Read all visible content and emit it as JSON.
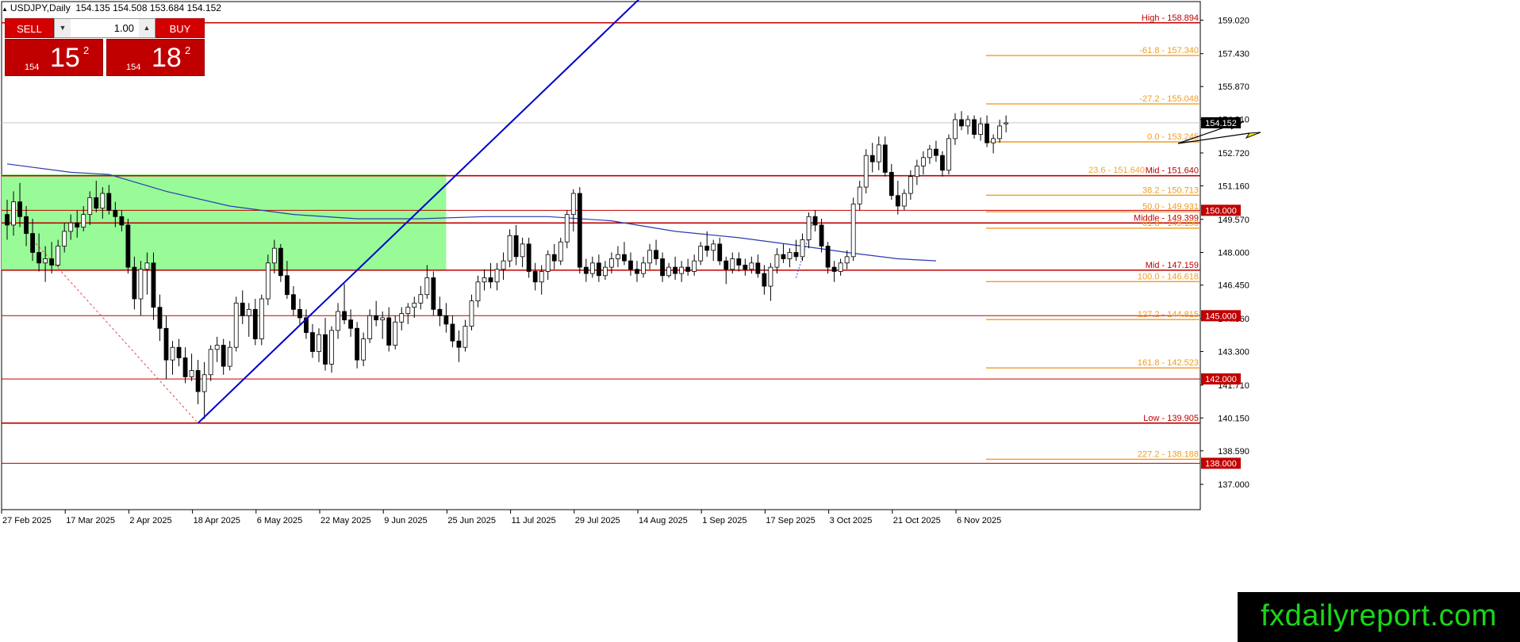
{
  "header": {
    "symbol": "USDJPY,Daily",
    "ohlc": "154.135 154.508 153.684 154.152"
  },
  "trade_panel": {
    "sell_label": "SELL",
    "buy_label": "BUY",
    "lot_value": "1.00",
    "sell_price": {
      "big": "154",
      "main": "15",
      "sup": "2"
    },
    "buy_price": {
      "big": "154",
      "main": "18",
      "sup": "2"
    }
  },
  "brand": "fxdailyreport.com",
  "colors": {
    "bull": "#ffffff",
    "bear": "#000000",
    "red_line": "#c00000",
    "fib": "#f39c1f",
    "trendline": "#0000cc",
    "ma": "#2b3bb0",
    "zone": "#98fb98"
  },
  "chart_data": {
    "type": "candlestick",
    "symbol": "USDJPY",
    "timeframe": "Daily",
    "ylim": [
      135.8,
      159.9
    ],
    "y_ticks": [
      "159.020",
      "157.430",
      "155.870",
      "154.310",
      "152.720",
      "151.160",
      "149.570",
      "148.000",
      "146.450",
      "144.860",
      "143.300",
      "141.710",
      "140.150",
      "138.590",
      "137.000"
    ],
    "x_ticks": [
      "27 Feb 2025",
      "17 Mar 2025",
      "2 Apr 2025",
      "18 Apr 2025",
      "6 May 2025",
      "22 May 2025",
      "9 Jun 2025",
      "25 Jun 2025",
      "11 Jul 2025",
      "29 Jul 2025",
      "14 Aug 2025",
      "1 Sep 2025",
      "17 Sep 2025",
      "3 Oct 2025",
      "21 Oct 2025",
      "6 Nov 2025"
    ],
    "current_price": "154.152",
    "candles": [
      [
        149.8,
        150.5,
        148.6,
        149.3
      ],
      [
        149.3,
        150.9,
        148.8,
        150.4
      ],
      [
        150.4,
        151.3,
        149.2,
        149.7
      ],
      [
        149.7,
        150.2,
        148.3,
        148.9
      ],
      [
        148.9,
        149.6,
        147.6,
        148.0
      ],
      [
        148.0,
        148.9,
        147.1,
        147.5
      ],
      [
        147.5,
        148.3,
        146.6,
        147.7
      ],
      [
        147.7,
        148.5,
        147.0,
        147.4
      ],
      [
        147.4,
        148.6,
        147.3,
        148.3
      ],
      [
        148.3,
        149.4,
        148.0,
        149.0
      ],
      [
        149.0,
        149.8,
        148.6,
        149.4
      ],
      [
        149.4,
        150.0,
        148.7,
        149.2
      ],
      [
        149.2,
        150.2,
        149.0,
        149.8
      ],
      [
        149.8,
        150.9,
        149.3,
        150.6
      ],
      [
        150.6,
        151.4,
        149.9,
        150.1
      ],
      [
        150.1,
        151.1,
        149.6,
        150.8
      ],
      [
        150.8,
        151.2,
        149.8,
        150.0
      ],
      [
        150.0,
        150.4,
        149.2,
        149.7
      ],
      [
        149.7,
        150.0,
        149.0,
        149.3
      ],
      [
        149.3,
        149.6,
        147.0,
        147.3
      ],
      [
        147.3,
        147.8,
        145.3,
        145.8
      ],
      [
        145.8,
        147.6,
        145.0,
        147.2
      ],
      [
        147.2,
        148.0,
        146.0,
        147.5
      ],
      [
        147.5,
        148.0,
        144.8,
        145.4
      ],
      [
        145.4,
        146.0,
        143.8,
        144.4
      ],
      [
        144.4,
        145.0,
        142.0,
        142.9
      ],
      [
        142.9,
        143.8,
        142.2,
        143.5
      ],
      [
        143.5,
        143.9,
        142.6,
        143.0
      ],
      [
        143.0,
        143.5,
        141.8,
        142.1
      ],
      [
        142.1,
        143.2,
        141.9,
        142.4
      ],
      [
        142.4,
        142.9,
        140.8,
        141.4
      ],
      [
        141.4,
        142.8,
        140.1,
        142.2
      ],
      [
        142.2,
        143.6,
        141.9,
        143.4
      ],
      [
        143.4,
        144.0,
        142.8,
        143.6
      ],
      [
        143.6,
        143.9,
        142.2,
        142.6
      ],
      [
        142.6,
        143.8,
        142.4,
        143.5
      ],
      [
        143.5,
        145.9,
        143.3,
        145.6
      ],
      [
        145.6,
        146.2,
        144.6,
        145.0
      ],
      [
        145.0,
        145.6,
        144.0,
        145.3
      ],
      [
        145.3,
        145.8,
        143.6,
        143.9
      ],
      [
        143.9,
        146.0,
        143.6,
        145.8
      ],
      [
        145.8,
        147.9,
        145.5,
        147.5
      ],
      [
        147.5,
        148.6,
        147.0,
        148.2
      ],
      [
        148.2,
        148.4,
        146.6,
        146.9
      ],
      [
        146.9,
        147.6,
        145.8,
        146.0
      ],
      [
        146.0,
        146.4,
        145.0,
        145.3
      ],
      [
        145.3,
        145.8,
        144.6,
        144.9
      ],
      [
        144.9,
        145.3,
        143.9,
        144.2
      ],
      [
        144.2,
        144.6,
        143.0,
        143.3
      ],
      [
        143.3,
        144.4,
        142.8,
        144.1
      ],
      [
        144.1,
        144.9,
        142.4,
        142.7
      ],
      [
        142.7,
        144.5,
        142.3,
        144.3
      ],
      [
        144.3,
        145.6,
        143.9,
        145.2
      ],
      [
        145.2,
        146.5,
        144.6,
        144.8
      ],
      [
        144.8,
        145.3,
        144.0,
        144.4
      ],
      [
        144.4,
        144.7,
        142.5,
        142.9
      ],
      [
        142.9,
        144.2,
        142.6,
        143.9
      ],
      [
        143.9,
        145.3,
        143.7,
        145.0
      ],
      [
        145.0,
        145.7,
        144.5,
        144.8
      ],
      [
        144.8,
        145.2,
        143.9,
        144.9
      ],
      [
        144.9,
        145.4,
        143.3,
        143.6
      ],
      [
        143.6,
        145.0,
        143.4,
        144.7
      ],
      [
        144.7,
        145.4,
        144.3,
        145.1
      ],
      [
        145.1,
        145.6,
        144.6,
        145.4
      ],
      [
        145.4,
        145.9,
        144.9,
        145.6
      ],
      [
        145.6,
        146.4,
        145.3,
        146.0
      ],
      [
        146.0,
        147.4,
        145.8,
        146.8
      ],
      [
        146.8,
        147.1,
        145.0,
        145.3
      ],
      [
        145.3,
        145.9,
        144.5,
        145.0
      ],
      [
        145.0,
        145.6,
        144.2,
        144.6
      ],
      [
        144.6,
        145.0,
        143.5,
        143.8
      ],
      [
        143.8,
        144.3,
        142.8,
        143.5
      ],
      [
        143.5,
        144.8,
        143.3,
        144.5
      ],
      [
        144.5,
        146.0,
        144.3,
        145.7
      ],
      [
        145.7,
        146.9,
        145.4,
        146.6
      ],
      [
        146.6,
        147.2,
        146.2,
        146.8
      ],
      [
        146.8,
        147.5,
        146.3,
        146.6
      ],
      [
        146.6,
        147.5,
        146.2,
        147.2
      ],
      [
        147.2,
        148.0,
        146.7,
        147.6
      ],
      [
        147.6,
        149.1,
        147.3,
        148.8
      ],
      [
        148.8,
        149.3,
        147.4,
        147.8
      ],
      [
        147.8,
        148.7,
        147.3,
        148.4
      ],
      [
        148.4,
        148.7,
        146.8,
        147.1
      ],
      [
        147.1,
        147.5,
        146.2,
        146.6
      ],
      [
        146.6,
        147.4,
        146.0,
        147.1
      ],
      [
        147.1,
        148.1,
        146.7,
        147.9
      ],
      [
        147.9,
        148.4,
        147.2,
        147.6
      ],
      [
        147.6,
        148.7,
        147.4,
        148.5
      ],
      [
        148.5,
        150.0,
        148.2,
        149.8
      ],
      [
        149.8,
        151.0,
        149.0,
        150.8
      ],
      [
        150.8,
        151.1,
        147.0,
        147.3
      ],
      [
        147.3,
        147.7,
        146.6,
        147.0
      ],
      [
        147.0,
        147.8,
        146.8,
        147.5
      ],
      [
        147.5,
        147.9,
        146.6,
        146.9
      ],
      [
        146.9,
        147.6,
        146.7,
        147.3
      ],
      [
        147.3,
        148.0,
        147.0,
        147.7
      ],
      [
        147.7,
        148.3,
        147.3,
        147.9
      ],
      [
        147.9,
        148.5,
        147.4,
        147.6
      ],
      [
        147.6,
        148.0,
        146.9,
        147.2
      ],
      [
        147.2,
        147.6,
        146.6,
        147.0
      ],
      [
        147.0,
        147.8,
        146.8,
        147.5
      ],
      [
        147.5,
        148.4,
        147.2,
        148.1
      ],
      [
        148.1,
        148.6,
        147.4,
        147.7
      ],
      [
        147.7,
        148.0,
        146.6,
        146.9
      ],
      [
        146.9,
        147.5,
        146.8,
        147.3
      ],
      [
        147.3,
        147.8,
        146.7,
        147.0
      ],
      [
        147.0,
        147.6,
        146.6,
        147.3
      ],
      [
        147.3,
        147.7,
        146.9,
        147.1
      ],
      [
        147.1,
        147.9,
        146.9,
        147.6
      ],
      [
        147.6,
        148.5,
        147.4,
        148.3
      ],
      [
        148.3,
        149.0,
        147.8,
        148.1
      ],
      [
        148.1,
        148.6,
        147.6,
        148.4
      ],
      [
        148.4,
        148.7,
        147.4,
        147.6
      ],
      [
        147.6,
        147.8,
        146.5,
        147.2
      ],
      [
        147.2,
        148.0,
        147.0,
        147.7
      ],
      [
        147.7,
        148.0,
        147.1,
        147.4
      ],
      [
        147.4,
        147.7,
        146.9,
        147.2
      ],
      [
        147.2,
        147.8,
        147.0,
        147.5
      ],
      [
        147.5,
        147.9,
        146.8,
        147.0
      ],
      [
        147.0,
        147.4,
        146.0,
        146.4
      ],
      [
        146.4,
        147.5,
        145.7,
        147.3
      ],
      [
        147.3,
        148.2,
        147.0,
        147.9
      ],
      [
        147.9,
        148.4,
        147.5,
        147.7
      ],
      [
        147.7,
        148.2,
        147.3,
        148.0
      ],
      [
        148.0,
        148.6,
        147.6,
        147.8
      ],
      [
        147.8,
        148.9,
        147.6,
        148.6
      ],
      [
        148.6,
        149.9,
        148.2,
        149.7
      ],
      [
        149.7,
        150.0,
        149.0,
        149.3
      ],
      [
        149.3,
        149.6,
        148.0,
        148.3
      ],
      [
        148.3,
        148.5,
        147.0,
        147.3
      ],
      [
        147.3,
        147.6,
        146.6,
        147.1
      ],
      [
        147.1,
        147.7,
        146.9,
        147.5
      ],
      [
        147.5,
        148.1,
        147.2,
        147.8
      ],
      [
        147.8,
        150.6,
        147.6,
        150.3
      ],
      [
        150.3,
        151.4,
        150.0,
        151.1
      ],
      [
        151.1,
        152.9,
        150.8,
        152.6
      ],
      [
        152.6,
        153.2,
        151.8,
        152.3
      ],
      [
        152.3,
        153.5,
        151.9,
        153.1
      ],
      [
        153.1,
        153.5,
        151.6,
        151.8
      ],
      [
        151.8,
        152.2,
        150.5,
        150.7
      ],
      [
        150.7,
        151.4,
        149.8,
        150.2
      ],
      [
        150.2,
        151.0,
        150.0,
        150.8
      ],
      [
        150.8,
        151.9,
        150.5,
        151.6
      ],
      [
        151.6,
        152.4,
        151.2,
        152.1
      ],
      [
        152.1,
        152.8,
        151.7,
        152.5
      ],
      [
        152.5,
        153.1,
        152.2,
        152.9
      ],
      [
        152.9,
        153.3,
        152.3,
        152.6
      ],
      [
        152.6,
        152.8,
        151.6,
        151.9
      ],
      [
        151.9,
        153.6,
        151.7,
        153.4
      ],
      [
        153.4,
        154.6,
        153.1,
        154.3
      ],
      [
        154.3,
        154.7,
        153.8,
        154.0
      ],
      [
        154.0,
        154.5,
        153.6,
        154.3
      ],
      [
        154.3,
        154.5,
        153.4,
        153.6
      ],
      [
        153.6,
        154.4,
        153.3,
        154.1
      ],
      [
        154.1,
        154.5,
        153.0,
        153.2
      ],
      [
        153.2,
        153.6,
        152.7,
        153.4
      ],
      [
        153.4,
        154.3,
        153.2,
        154.0
      ],
      [
        154.1,
        154.5,
        153.7,
        154.15
      ]
    ],
    "levels": [
      {
        "label": "High - 158.894",
        "value": 158.894,
        "style": "red"
      },
      {
        "label": "-61.8 - 157.340",
        "value": 157.34,
        "style": "fib"
      },
      {
        "label": "-27.2 - 155.048",
        "value": 155.048,
        "style": "fib"
      },
      {
        "label": "0.0 - 153.245",
        "value": 153.245,
        "style": "fib"
      },
      {
        "label": "Mid - 151.640",
        "value": 151.64,
        "style": "red"
      },
      {
        "label": "23.6 - 151.640",
        "value": 151.66,
        "style": "fib-hidden"
      },
      {
        "label": "38.2 - 150.713",
        "value": 150.713,
        "style": "fib"
      },
      {
        "label": "50.0 - 149.931",
        "value": 149.931,
        "style": "fib"
      },
      {
        "label": "Middle - 149.399",
        "value": 149.399,
        "style": "red"
      },
      {
        "label": "61.8 - 149.150",
        "value": 149.15,
        "style": "fib"
      },
      {
        "label": "Mid - 147.159",
        "value": 147.159,
        "style": "red"
      },
      {
        "label": "100.0 - 146.618",
        "value": 146.618,
        "style": "fib"
      },
      {
        "label": "127.2 - 144.815",
        "value": 144.815,
        "style": "fib"
      },
      {
        "label": "161.8 - 142.523",
        "value": 142.523,
        "style": "fib"
      },
      {
        "label": "Low - 139.905",
        "value": 139.905,
        "style": "red"
      },
      {
        "label": "227.2 - 138.188",
        "value": 138.188,
        "style": "fib"
      }
    ],
    "round_levels": [
      {
        "label": "150.000",
        "value": 150.0
      },
      {
        "label": "145.000",
        "value": 145.0
      },
      {
        "label": "142.000",
        "value": 142.0
      },
      {
        "label": "138.000",
        "value": 138.0
      }
    ],
    "zone": {
      "from_index": 0,
      "to_index": 69,
      "low": 147.159,
      "high": 151.7
    },
    "trendline": {
      "from_index": 30,
      "from_price": 139.905,
      "to_index": 101,
      "to_price": 160.5
    },
    "moving_average": [
      [
        0,
        152.2
      ],
      [
        10,
        151.8
      ],
      [
        16,
        151.7
      ],
      [
        25,
        150.9
      ],
      [
        35,
        150.2
      ],
      [
        45,
        149.8
      ],
      [
        55,
        149.6
      ],
      [
        65,
        149.6
      ],
      [
        75,
        149.7
      ],
      [
        85,
        149.7
      ],
      [
        95,
        149.5
      ],
      [
        105,
        149.0
      ],
      [
        115,
        148.7
      ],
      [
        125,
        148.3
      ],
      [
        132,
        148.0
      ],
      [
        140,
        147.7
      ],
      [
        146,
        147.6
      ]
    ]
  }
}
